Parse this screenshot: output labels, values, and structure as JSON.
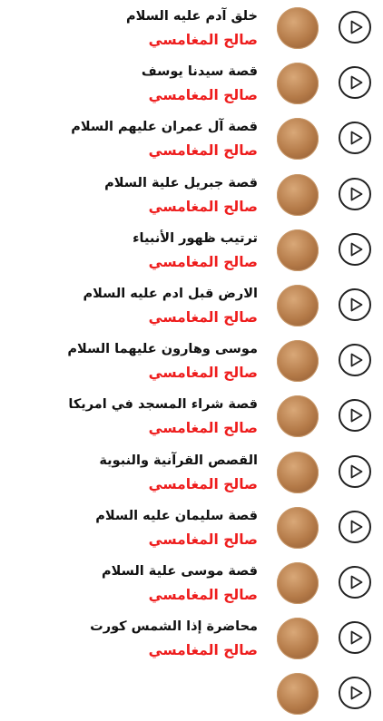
{
  "colors": {
    "title": "#111111",
    "artist": "#ee1c1c",
    "play_ring": "#222222",
    "thumbnail": "#b47a48"
  },
  "playlist": {
    "items": [
      {
        "title": "خلق آدم عليه السلام",
        "artist": "صالح المغامسي",
        "thumbnail_icon": "prophets-stories-thumbnail",
        "play_icon": "play-icon"
      },
      {
        "title": "قصة سيدنا يوسف",
        "artist": "صالح المغامسي",
        "thumbnail_icon": "prophets-stories-thumbnail",
        "play_icon": "play-icon"
      },
      {
        "title": "قصة آل عمران عليهم السلام",
        "artist": "صالح المغامسي",
        "thumbnail_icon": "prophets-stories-thumbnail",
        "play_icon": "play-icon"
      },
      {
        "title": "قصة جبريل علية السلام",
        "artist": "صالح المغامسي",
        "thumbnail_icon": "prophets-stories-thumbnail",
        "play_icon": "play-icon"
      },
      {
        "title": "ترتيب ظهور الأنبياء",
        "artist": "صالح المغامسي",
        "thumbnail_icon": "prophets-stories-thumbnail",
        "play_icon": "play-icon"
      },
      {
        "title": "الارض قبل ادم عليه السلام",
        "artist": "صالح المغامسي",
        "thumbnail_icon": "prophets-stories-thumbnail",
        "play_icon": "play-icon"
      },
      {
        "title": "موسى وهارون عليهما السلام",
        "artist": "صالح المغامسي",
        "thumbnail_icon": "prophets-stories-thumbnail",
        "play_icon": "play-icon"
      },
      {
        "title": "قصة شراء المسجد في امريكا",
        "artist": "صالح المغامسي",
        "thumbnail_icon": "prophets-stories-thumbnail",
        "play_icon": "play-icon"
      },
      {
        "title": "القصص القرآنية والنبوية",
        "artist": "صالح المغامسي",
        "thumbnail_icon": "prophets-stories-thumbnail",
        "play_icon": "play-icon"
      },
      {
        "title": "قصة سليمان عليه السلام",
        "artist": "صالح المغامسي",
        "thumbnail_icon": "prophets-stories-thumbnail",
        "play_icon": "play-icon"
      },
      {
        "title": "قصة موسى علية السلام",
        "artist": "صالح المغامسي",
        "thumbnail_icon": "prophets-stories-thumbnail",
        "play_icon": "play-icon"
      },
      {
        "title": "محاضرة إذا الشمس كورت",
        "artist": "صالح المغامسي",
        "thumbnail_icon": "prophets-stories-thumbnail",
        "play_icon": "play-icon"
      },
      {
        "title": "",
        "artist": "",
        "thumbnail_icon": "prophets-stories-thumbnail",
        "play_icon": "play-icon"
      }
    ]
  }
}
